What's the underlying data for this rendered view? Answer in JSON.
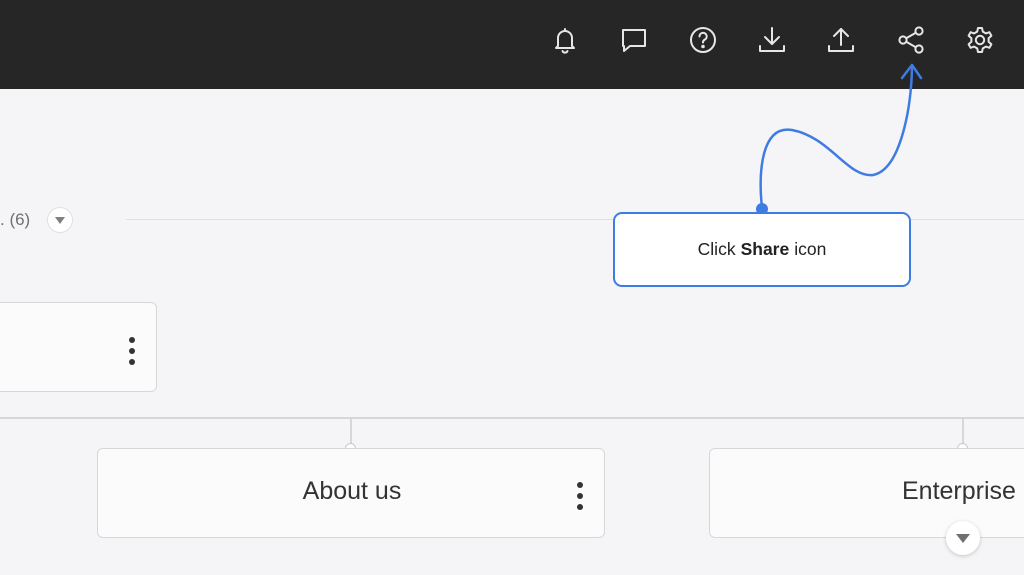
{
  "topbar": {
    "icons": [
      "bell-icon",
      "chat-icon",
      "help-icon",
      "download-icon",
      "upload-icon",
      "share-icon",
      "settings-icon"
    ]
  },
  "section": {
    "label": ". (6)"
  },
  "cards": {
    "left_card_title": "",
    "about_title": "About us",
    "enterprise_title": "Enterprise"
  },
  "callout": {
    "prefix": "Click",
    "bold": "Share",
    "suffix": "icon"
  },
  "colors": {
    "topbar": "#262626",
    "background": "#f5f5f7",
    "accent": "#3f7be4"
  }
}
